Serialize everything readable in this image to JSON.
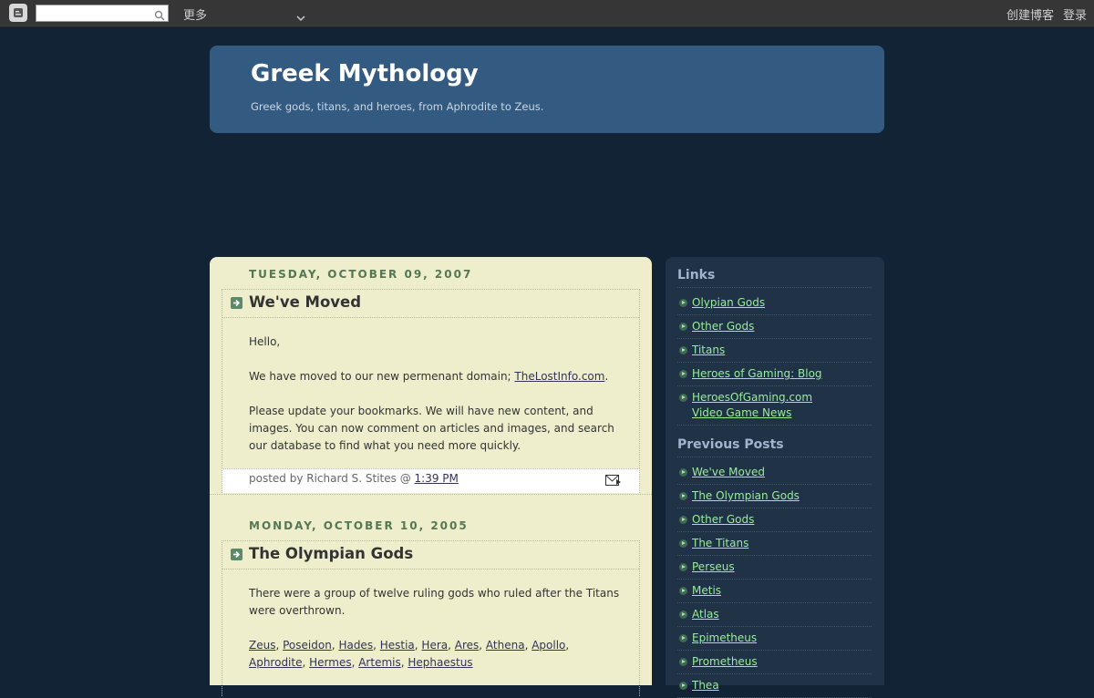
{
  "navbar": {
    "search_placeholder": "",
    "more_label": "更多",
    "create_blog": "创建博客",
    "sign_in": "登录"
  },
  "header": {
    "title": "Greek Mythology",
    "description": "Greek gods, titans, and heroes, from Aphrodite to Zeus."
  },
  "posts": [
    {
      "date": "TUESDAY, OCTOBER 09, 2007",
      "title": "We've Moved",
      "p1": "Hello,",
      "p2_prefix": "We have moved to our new permenant domain; ",
      "p2_link": "TheLostInfo.com",
      "p2_suffix": ".",
      "p3": "Please update your bookmarks. We will have new content, and images. You can now comment on articles and images, and search our database to find what you need more quickly.",
      "footer_prefix": "posted by Richard S. Stites @ ",
      "time": "1:39 PM"
    },
    {
      "date": "MONDAY, OCTOBER 10, 2005",
      "title": "The Olympian Gods",
      "p1": "There were a group of twelve ruling gods who ruled after the Titans were overthrown.",
      "gods": [
        "Zeus",
        "Poseidon",
        "Hades",
        "Hestia",
        "Hera",
        "Ares",
        "Athena",
        "Apollo",
        "Aphrodite",
        "Hermes",
        "Artemis",
        "Hephaestus"
      ]
    }
  ],
  "sidebar": {
    "links_heading": "Links",
    "links": [
      "Olypian Gods",
      "Other Gods",
      "Titans",
      "Heroes of Gaming: Blog",
      "HeroesOfGaming.com Video Game News"
    ],
    "previous_heading": "Previous Posts",
    "previous": [
      "We've Moved",
      "The Olympian Gods",
      "Other Gods",
      "The Titans",
      "Perseus",
      "Metis",
      "Atlas",
      "Epimetheus",
      "Prometheus",
      "Thea"
    ]
  }
}
